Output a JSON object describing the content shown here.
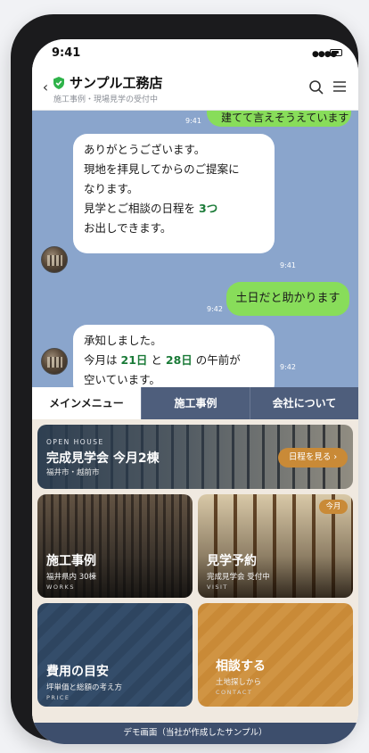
{
  "status_bar": {
    "time": "9:41"
  },
  "header": {
    "back_icon": "chevron-left-icon",
    "verified_icon": "shield-check-icon",
    "title": "サンプル工務店",
    "subtitle": "施工事例・現場見学の受付中",
    "search_icon": "search-icon",
    "menu_icon": "hamburger-menu-icon"
  },
  "chat": {
    "messages": [
      {
        "from": "user",
        "text": "建てて言えそうえています",
        "time": "9:41"
      },
      {
        "from": "shop",
        "lines": [
          "ありがとうございます。",
          "現地を拝見してからのご提案に",
          "なります。",
          "見学とご相談の日程を",
          "3つ",
          "お出しできます。"
        ],
        "time": "9:41"
      },
      {
        "from": "user",
        "text": "土日だと助かります",
        "time": "9:42"
      },
      {
        "from": "shop",
        "lines": [
          "承知しました。",
          "今月は",
          "21日",
          "と",
          "28日",
          "の午前が",
          "空いています。"
        ],
        "time": "9:42"
      }
    ]
  },
  "tabs": [
    {
      "label": "メインメニュー",
      "active": true
    },
    {
      "label": "施工事例",
      "active": false
    },
    {
      "label": "会社について",
      "active": false
    }
  ],
  "menu": {
    "open_house": {
      "eyebrow": "OPEN HOUSE",
      "title": "完成見学会 今月2棟",
      "location": "福井市・越前市",
      "button": "日程を見る ›"
    },
    "works": {
      "title": "施工事例",
      "sub": "福井県内 30棟",
      "en": "WORKS"
    },
    "visit": {
      "title": "見学予約",
      "sub": "完成見学会 受付中",
      "en": "VISIT",
      "badge": "今月"
    },
    "price": {
      "title": "費用の目安",
      "sub": "坪単価と総額の考え方",
      "en": "PRICE"
    },
    "contact": {
      "title": "相談する",
      "sub": "土地探しから",
      "en": "CONTACT"
    }
  },
  "footer": {
    "text": "デモ画面（当社が作成したサンプル）"
  },
  "colors": {
    "chat_bg": "#8aa5cc",
    "user_bubble": "#88dd5a",
    "highlight": "#1a7a37",
    "tab_bar": "#4e5e7c",
    "accent": "#c98a37",
    "navy": "#2e4560",
    "footer": "#3d4e6c"
  }
}
